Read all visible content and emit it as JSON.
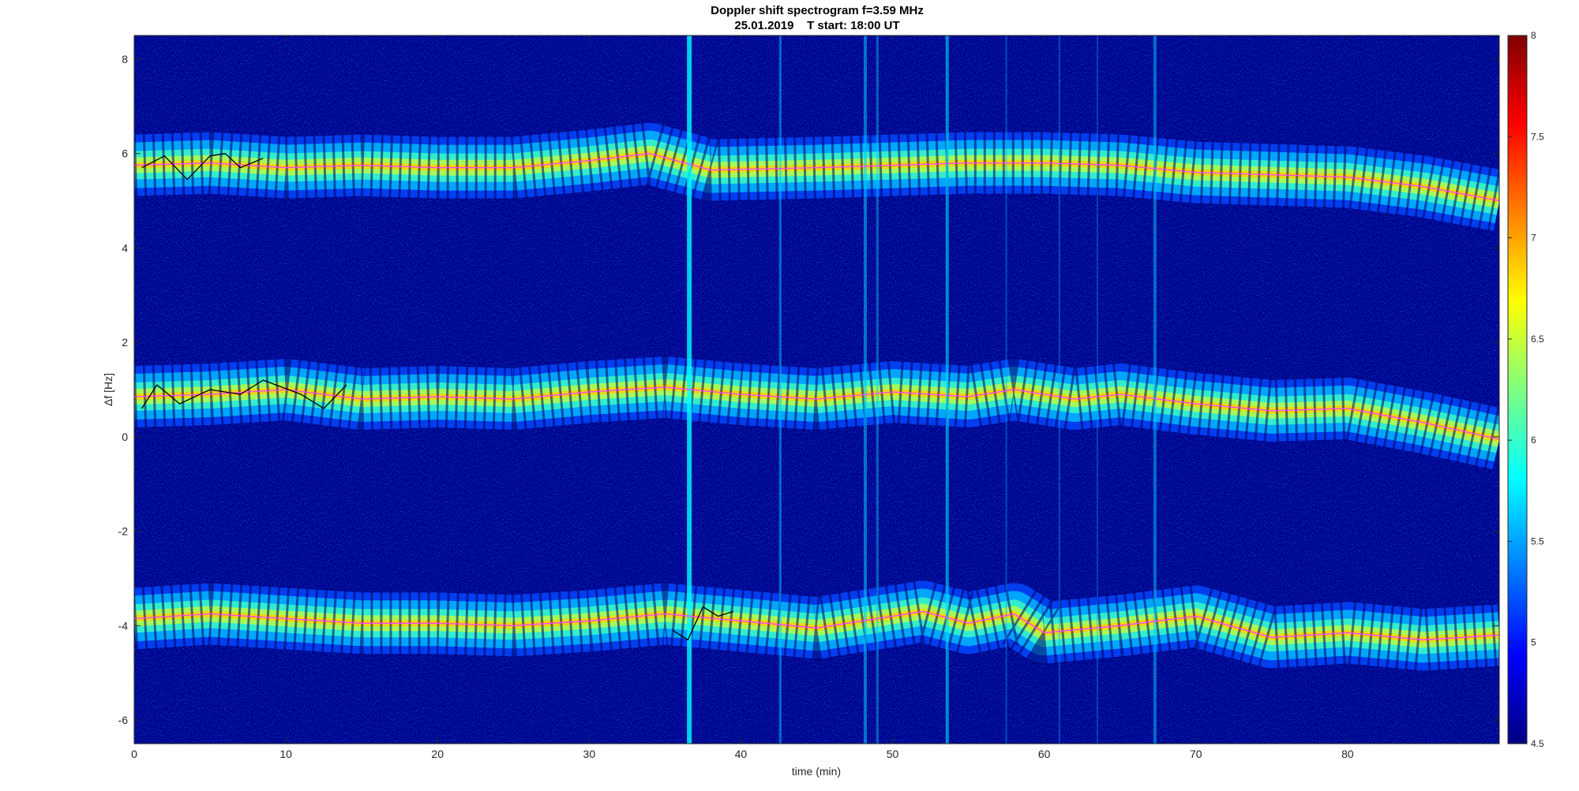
{
  "chart_data": {
    "type": "heatmap",
    "title": "Doppler shift spectrogram f=3.59 MHz",
    "subtitle": "25.01.2019    T start: 18:00 UT",
    "xlabel": "time (min)",
    "ylabel": "Δf [Hz]",
    "xlim": [
      0,
      90
    ],
    "ylim": [
      -6.5,
      8.5
    ],
    "xticks": [
      0,
      10,
      20,
      30,
      40,
      50,
      60,
      70,
      80
    ],
    "yticks": [
      -6,
      -4,
      -2,
      0,
      2,
      4,
      6,
      8
    ],
    "colorbar": {
      "colormap": "jet",
      "clim": [
        4.5,
        8
      ],
      "ticks": [
        4.5,
        5,
        5.5,
        6,
        6.5,
        7,
        7.5,
        8
      ]
    },
    "traces": [
      {
        "color": "#ff3cff",
        "x": [
          0,
          5,
          10,
          15,
          20,
          25,
          30,
          34,
          38,
          45,
          50,
          55,
          60,
          65,
          70,
          75,
          80,
          85,
          90
        ],
        "y": [
          5.75,
          5.8,
          5.7,
          5.75,
          5.7,
          5.7,
          5.85,
          6.0,
          5.65,
          5.7,
          5.75,
          5.8,
          5.8,
          5.75,
          5.6,
          5.55,
          5.5,
          5.3,
          5.0
        ]
      },
      {
        "color": "#ff3cff",
        "x": [
          0,
          5,
          10,
          15,
          20,
          25,
          30,
          35,
          40,
          45,
          50,
          55,
          58,
          62,
          65,
          70,
          75,
          80,
          85,
          90
        ],
        "y": [
          0.85,
          0.9,
          1.0,
          0.8,
          0.85,
          0.8,
          0.95,
          1.05,
          0.9,
          0.8,
          0.95,
          0.85,
          1.0,
          0.8,
          0.9,
          0.7,
          0.55,
          0.6,
          0.3,
          -0.05
        ]
      },
      {
        "color": "#ff3cff",
        "x": [
          0,
          5,
          10,
          15,
          20,
          25,
          30,
          35,
          40,
          45,
          50,
          52,
          55,
          58,
          60,
          65,
          70,
          75,
          80,
          85,
          90
        ],
        "y": [
          -3.85,
          -3.75,
          -3.85,
          -3.95,
          -3.95,
          -4.0,
          -3.9,
          -3.75,
          -3.9,
          -4.05,
          -3.8,
          -3.7,
          -3.95,
          -3.75,
          -4.15,
          -4.0,
          -3.8,
          -4.25,
          -4.15,
          -4.3,
          -4.2
        ]
      },
      {
        "color": "#000000",
        "x": [
          0.5,
          2,
          3.5,
          5,
          6,
          7,
          8.5
        ],
        "y": [
          5.7,
          5.95,
          5.45,
          5.95,
          6.0,
          5.7,
          5.9
        ]
      },
      {
        "color": "#000000",
        "x": [
          0.5,
          1.5,
          3,
          5,
          7,
          8.5,
          11,
          12.5,
          14
        ],
        "y": [
          0.6,
          1.1,
          0.7,
          1.0,
          0.9,
          1.2,
          0.9,
          0.6,
          1.1
        ]
      },
      {
        "color": "#000000",
        "x": [
          35.5,
          36.5,
          37.5,
          38.5,
          39.5
        ],
        "y": [
          -4.1,
          -4.3,
          -3.6,
          -3.8,
          -3.7
        ]
      }
    ]
  }
}
